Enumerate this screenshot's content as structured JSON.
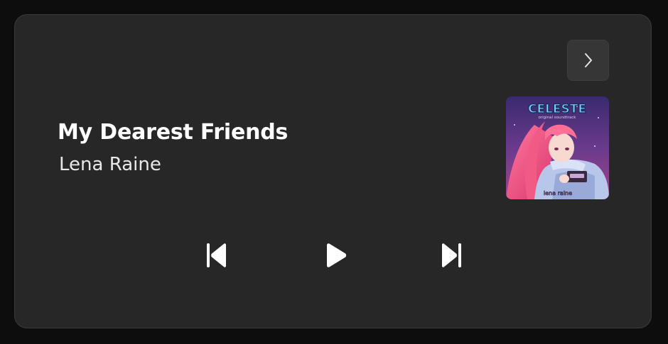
{
  "track": {
    "title": "My Dearest Friends",
    "artist": "Lena Raine"
  },
  "album_art": {
    "logo_text": "CELESTE",
    "subtitle_text": "original soundtrack",
    "caption_text": "lena raine"
  },
  "controls": {
    "expand_icon": "chevron-right-icon",
    "previous_icon": "skip-previous-icon",
    "play_icon": "play-icon",
    "next_icon": "skip-next-icon"
  },
  "colors": {
    "card_background": "#272727",
    "button_background": "#363636",
    "text_primary": "#ffffff"
  }
}
